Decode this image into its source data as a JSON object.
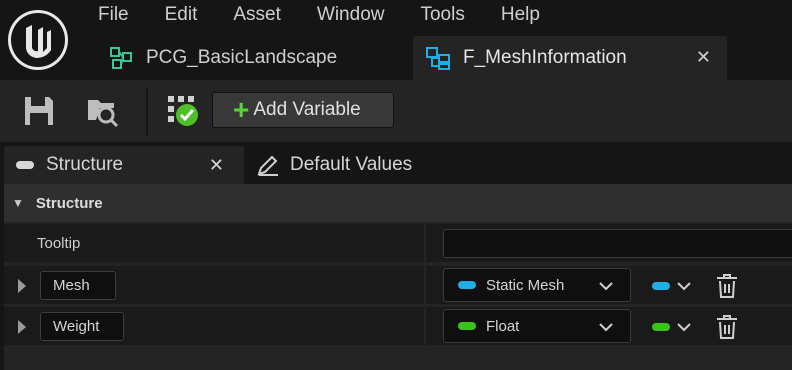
{
  "menu": [
    "File",
    "Edit",
    "Asset",
    "Window",
    "Tools",
    "Help"
  ],
  "document_tabs": [
    {
      "label": "PCG_BasicLandscape",
      "icon": "pcg-graph-icon"
    },
    {
      "label": "F_MeshInformation",
      "icon": "struct-icon",
      "close": "✕"
    }
  ],
  "toolbar": {
    "save_icon": "save-icon",
    "browse_icon": "browse-icon",
    "compile_icon": "compile-status-icon",
    "add_variable_plus": "+",
    "add_variable_label": "Add Variable"
  },
  "panel_tabs": [
    {
      "label": "Structure",
      "close": "✕"
    },
    {
      "label": "Default Values"
    }
  ],
  "structure": {
    "category": "Structure",
    "category_arrow": "▼",
    "tooltip_label": "Tooltip",
    "tooltip_value": "",
    "variables": [
      {
        "name": "Mesh",
        "type": "Static Mesh",
        "color": "#1faee6"
      },
      {
        "name": "Weight",
        "type": "Float",
        "color": "#39c21a"
      }
    ]
  },
  "colors": {
    "background": "#151515",
    "panel": "#242424",
    "row": "#1a1a1a",
    "object_type": "#1faee6",
    "float_type": "#39c21a",
    "add_green": "#5dcf3a"
  }
}
